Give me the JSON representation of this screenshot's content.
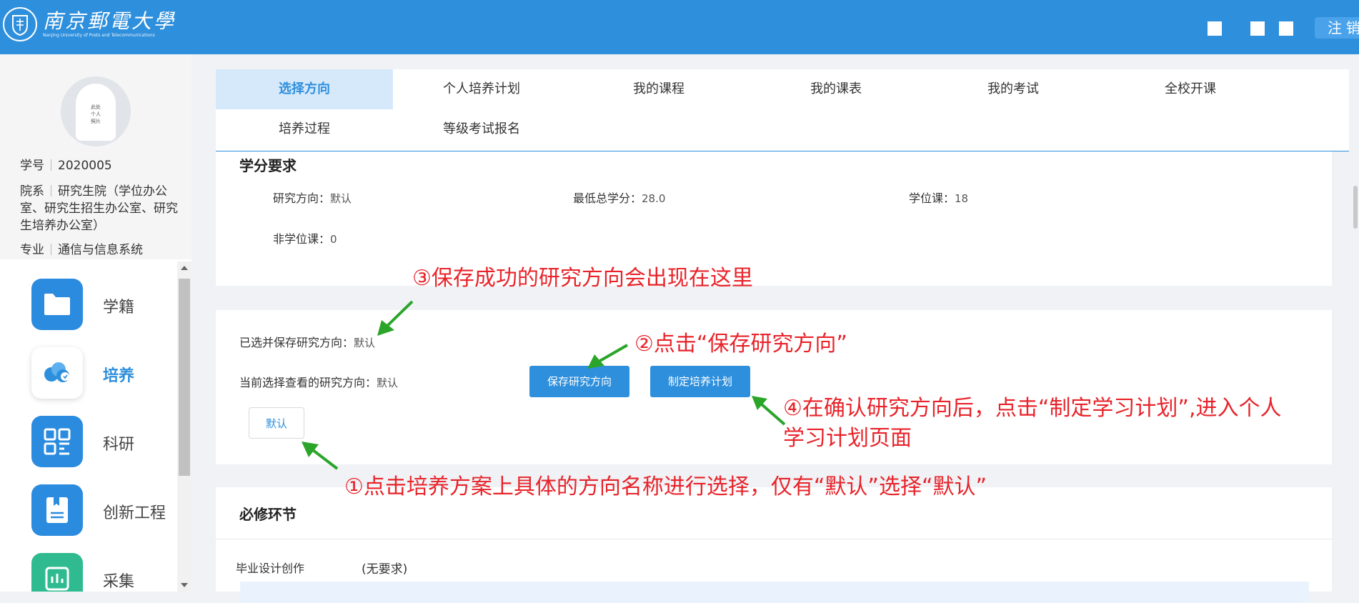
{
  "header": {
    "logo_cn": "南京郵電大學",
    "logo_en": "Nanjing University of Posts and Telecommunications",
    "logout_label": "注销"
  },
  "profile": {
    "avatar_text": "此处个人照片",
    "student_id_label": "学号",
    "student_id": "2020005",
    "dept_label": "院系",
    "dept": "研究生院（学位办公室、研究生招生办公室、研究生培养办公室）",
    "major_label": "专业",
    "major": "通信与信息系统"
  },
  "menu": {
    "items": [
      {
        "label": "学籍",
        "icon": "folder-icon"
      },
      {
        "label": "培养",
        "icon": "cloud-icon"
      },
      {
        "label": "科研",
        "icon": "qr-icon"
      },
      {
        "label": "创新工程",
        "icon": "document-icon"
      },
      {
        "label": "采集",
        "icon": "chart-icon"
      }
    ]
  },
  "tabs": [
    "选择方向",
    "个人培养计划",
    "我的课程",
    "我的课表",
    "我的考试",
    "全校开课",
    "培养过程",
    "等级考试报名"
  ],
  "credits": {
    "title": "学分要求",
    "direction_label": "研究方向：",
    "direction_value": "默认",
    "min_total_label": "最低总学分：",
    "min_total_value": "28.0",
    "degree_label": "学位课：",
    "degree_value": "18",
    "non_degree_label": "非学位课：",
    "non_degree_value": "0"
  },
  "selection": {
    "saved_label": "已选并保存研究方向：",
    "saved_value": "默认",
    "current_label": "当前选择查看的研究方向：",
    "current_value": "默认",
    "save_button": "保存研究方向",
    "plan_button": "制定培养计划",
    "direction_option": "默认"
  },
  "required": {
    "title": "必修环节",
    "item_label": "毕业设计创作",
    "item_value": "(无要求)"
  },
  "annotations": {
    "a1": "①点击培养方案上具体的方向名称进行选择，仅有“默认”选择“默认”",
    "a2": "②点击“保存研究方向”",
    "a3": "③保存成功的研究方向会出现在这里",
    "a4_line1": "④在确认研究方向后，点击“制定学习计划”,进入个人",
    "a4_line2": "学习计划页面"
  },
  "colors": {
    "brand": "#2e8fdc",
    "annotation": "#e8232a",
    "arrow": "#2aa52a"
  }
}
